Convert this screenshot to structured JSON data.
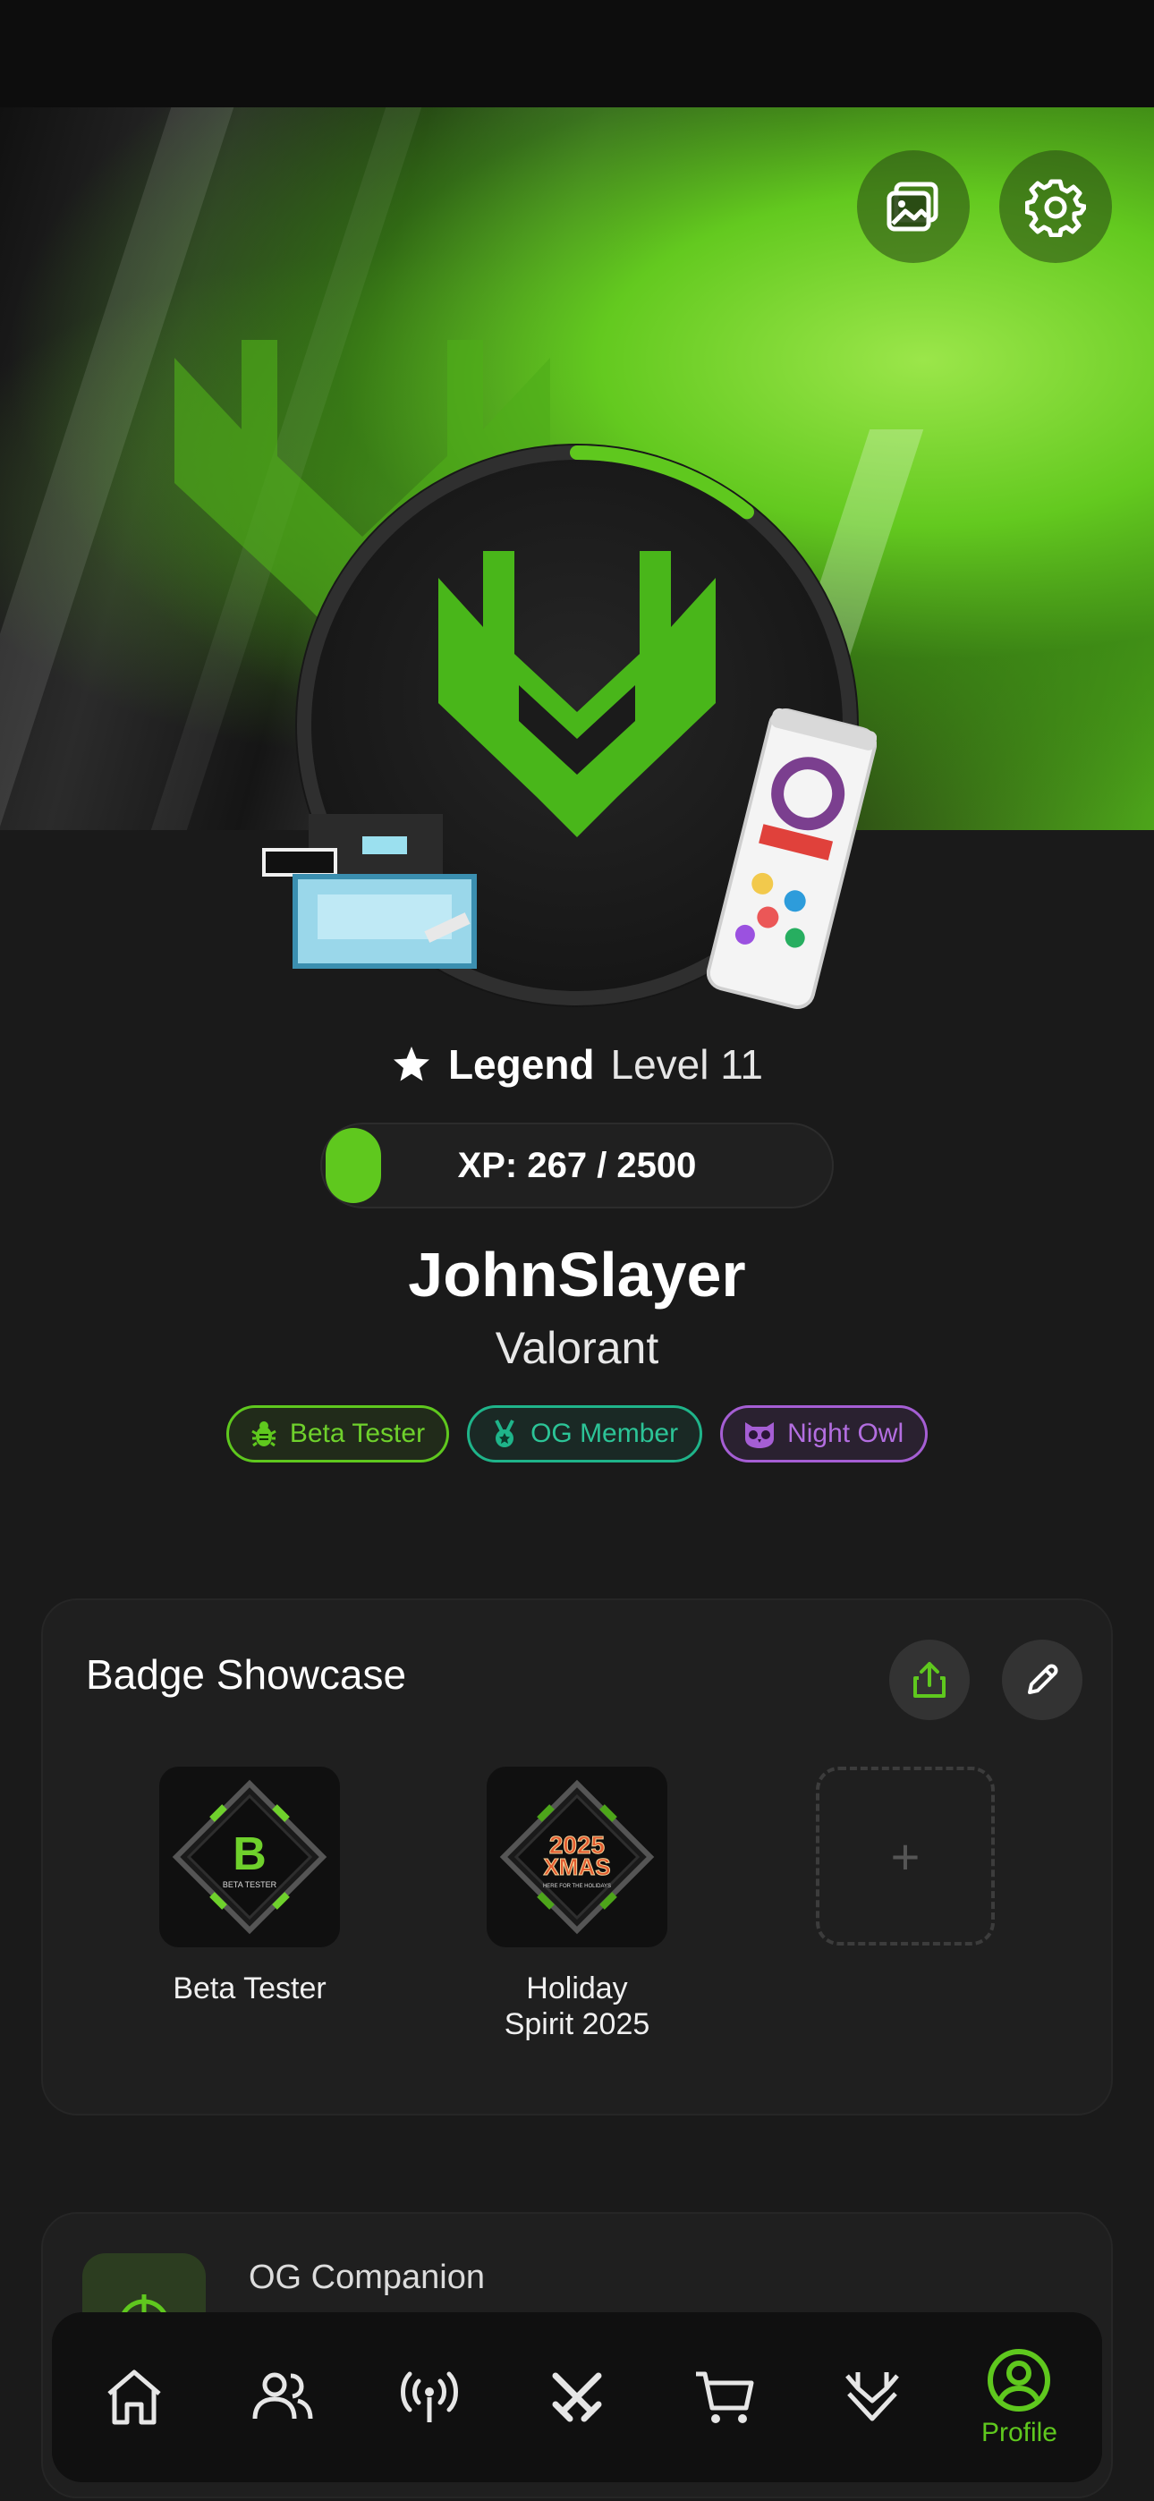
{
  "colors": {
    "accent": "#5fc81e",
    "background": "#1a1a1a",
    "card": "#1f1f1f",
    "og_teal": "#1fb48a",
    "night_owl_purple": "#a55ed4"
  },
  "header": {
    "gallery_icon": "image-icon",
    "settings_icon": "gear-icon"
  },
  "profile": {
    "rank": "Legend",
    "level": "Level 11",
    "xp_text": "XP: 267 / 2500",
    "xp_current": 267,
    "xp_max": 2500,
    "ring_progress": 0.107,
    "username": "JohnSlayer",
    "game": "Valorant"
  },
  "tags": [
    {
      "label": "Beta Tester",
      "icon": "bug-icon",
      "color": "#5fc81e"
    },
    {
      "label": "OG Member",
      "icon": "medal-icon",
      "color": "#1fb48a"
    },
    {
      "label": "Night Owl",
      "icon": "owl-icon",
      "color": "#a55ed4"
    }
  ],
  "badge_showcase": {
    "title": "Badge Showcase",
    "badges": [
      {
        "label": "Beta Tester",
        "tile_letter": "B",
        "tile_caption": "BETA TESTER"
      },
      {
        "label": "Holiday\nSpirit 2025",
        "tile_year": "2025",
        "tile_word": "XMAS",
        "tile_caption": "HERE FOR THE HOLIDAYS"
      }
    ],
    "empty_slot_symbol": "+"
  },
  "companion": {
    "title": "OG Companion"
  },
  "nav": {
    "items": [
      {
        "icon": "home-icon"
      },
      {
        "icon": "friends-icon"
      },
      {
        "icon": "broadcast-icon"
      },
      {
        "icon": "swords-icon"
      },
      {
        "icon": "cart-icon"
      },
      {
        "icon": "logo-icon"
      },
      {
        "icon": "profile-icon",
        "label": "Profile",
        "active": true
      }
    ]
  }
}
